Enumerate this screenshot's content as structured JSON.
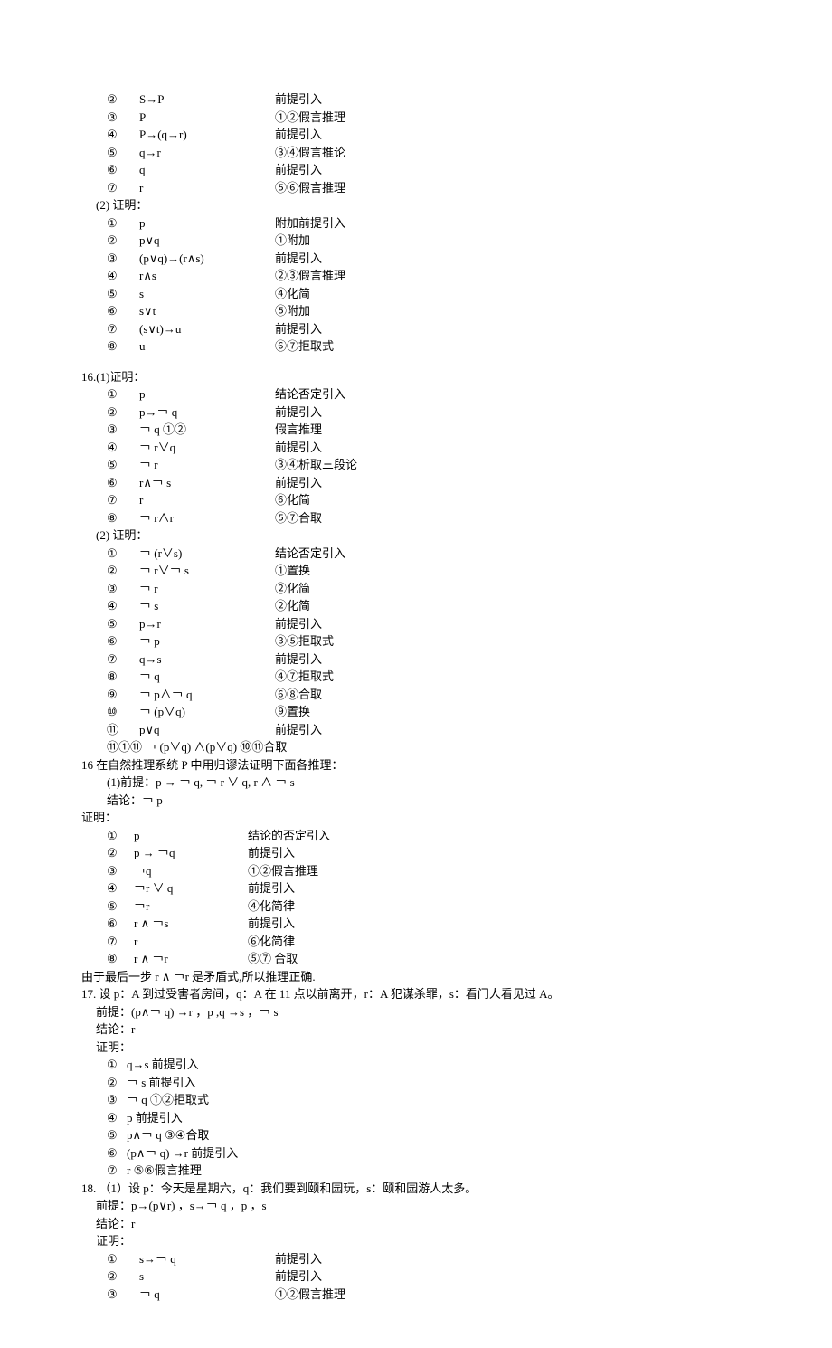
{
  "blockA": {
    "steps": [
      {
        "n": "②",
        "f": "S→P",
        "r": "前提引入"
      },
      {
        "n": "③",
        "f": "P",
        "r": "①②假言推理"
      },
      {
        "n": "④",
        "f": "P→(q→r)",
        "r": "前提引入"
      },
      {
        "n": "⑤",
        "f": "q→r",
        "r": "③④假言推论"
      },
      {
        "n": "⑥",
        "f": "q",
        "r": "前提引入"
      },
      {
        "n": "⑦",
        "f": "r",
        "r": "⑤⑥假言推理"
      }
    ]
  },
  "blockB": {
    "header": "(2) 证明：",
    "steps": [
      {
        "n": "①",
        "f": "p",
        "r": "附加前提引入"
      },
      {
        "n": "②",
        "f": "p∨q",
        "r": "①附加"
      },
      {
        "n": "③",
        "f": "(p∨q)→(r∧s)",
        "r": "前提引入"
      },
      {
        "n": "④",
        "f": "r∧s",
        "r": "②③假言推理"
      },
      {
        "n": "⑤",
        "f": "s",
        "r": "④化简"
      },
      {
        "n": "⑥",
        "f": "s∨t",
        "r": "⑤附加"
      },
      {
        "n": "⑦",
        "f": "(s∨t)→u",
        "r": "前提引入"
      },
      {
        "n": "⑧",
        "f": "u",
        "r": "⑥⑦拒取式"
      }
    ]
  },
  "block16a": {
    "header": "16.(1)证明：",
    "steps": [
      {
        "n": "①",
        "f": "p",
        "r": "结论否定引入"
      },
      {
        "n": "②",
        "f": "p→￢ q",
        "r": "前提引入"
      },
      {
        "n": "③",
        "f": "￢ q ①②",
        "r": "假言推理"
      },
      {
        "n": "④",
        "f": "￢ r∨q",
        "r": "前提引入"
      },
      {
        "n": "⑤",
        "f": "￢ r",
        "r": "③④析取三段论"
      },
      {
        "n": "⑥",
        "f": "r∧￢ s",
        "r": "前提引入"
      },
      {
        "n": "⑦",
        "f": "r",
        "r": "⑥化简"
      },
      {
        "n": "⑧",
        "f": "￢ r∧r",
        "r": "⑤⑦合取"
      }
    ]
  },
  "block16b": {
    "header": "(2) 证明：",
    "steps": [
      {
        "n": "①",
        "f": "￢ (r∨s)",
        "r": "结论否定引入"
      },
      {
        "n": "②",
        "f": "￢ r∨￢ s",
        "r": "①置换"
      },
      {
        "n": "③",
        "f": "￢ r",
        "r": "②化简"
      },
      {
        "n": "④",
        "f": "￢ s",
        "r": "②化简"
      },
      {
        "n": "⑤",
        "f": "p→r",
        "r": "前提引入"
      },
      {
        "n": "⑥",
        "f": "￢ p",
        "r": "③⑤拒取式"
      },
      {
        "n": "⑦",
        "f": "q→s",
        "r": "前提引入"
      },
      {
        "n": "⑧",
        "f": "￢ q",
        "r": "④⑦拒取式"
      },
      {
        "n": "⑨",
        "f": "￢ p∧￢ q",
        "r": "⑥⑧合取"
      },
      {
        "n": "⑩",
        "f": "￢ (p∨q)",
        "r": "⑨置换"
      },
      {
        "n": "⑪",
        "f": "p∨q",
        "r": "前提引入"
      }
    ],
    "final": "⑪①⑪ ￢ (p∨q) ∧(p∨q) ⑩⑪合取",
    "sec_title": "16 在自然推理系统 P 中用归谬法证明下面各推理：",
    "premise": "(1)前提：p → ￢ q, ￢ r ∨ q, r ∧ ￢ s",
    "conclusion": "结论：￢ p",
    "proof_label": "证明："
  },
  "block16c": {
    "steps": [
      {
        "n": "①",
        "f": "p",
        "r": "结论的否定引入"
      },
      {
        "n": "②",
        "f": "p → ￢q",
        "r": "前提引入"
      },
      {
        "n": "③",
        "f": "￢q",
        "r": "①②假言推理"
      },
      {
        "n": "④",
        "f": "￢r ∨ q",
        "r": "前提引入"
      },
      {
        "n": "⑤",
        "f": "￢r",
        "r": "④化简律"
      },
      {
        "n": "⑥",
        "f": "r ∧ ￢s",
        "r": "前提引入"
      },
      {
        "n": "⑦",
        "f": "r",
        "r": "⑥化简律"
      },
      {
        "n": "⑧",
        "f": "r ∧ ￢r",
        "r": "⑤⑦ 合取"
      }
    ],
    "closing": "由于最后一步 r ∧ ￢r 是矛盾式,所以推理正确."
  },
  "block17": {
    "header": "17.  设 p：A 到过受害者房间，q：A 在 11 点以前离开，r：A 犯谋杀罪，s：看门人看见过 A。",
    "premise": "前提：(p∧￢ q) →r ，p ,q →s ，￢ s",
    "conclusion": "结论：r",
    "proof_label": "证明：",
    "steps": [
      {
        "n": "①",
        "f": "q→s 前提引入"
      },
      {
        "n": "②",
        "f": "￢ s 前提引入"
      },
      {
        "n": "③",
        "f": "￢ q ①②拒取式"
      },
      {
        "n": "④",
        "f": "p 前提引入"
      },
      {
        "n": "⑤",
        "f": "p∧￢ q ③④合取"
      },
      {
        "n": "⑥",
        "f": "(p∧￢ q) →r 前提引入"
      },
      {
        "n": "⑦",
        "f": "r ⑤⑥假言推理"
      }
    ]
  },
  "block18": {
    "header": "18.  （1）设 p：今天是星期六，q：我们要到颐和园玩，s：颐和园游人太多。",
    "premise": "前提：p→(p∨r) ，s→￢ q ，p ，s",
    "conclusion": "结论：r",
    "proof_label": "证明：",
    "steps": [
      {
        "n": "①",
        "f": "s→￢ q",
        "r": "前提引入"
      },
      {
        "n": "②",
        "f": "s",
        "r": "前提引入"
      },
      {
        "n": "③",
        "f": "￢ q",
        "r": "①②假言推理"
      }
    ]
  }
}
